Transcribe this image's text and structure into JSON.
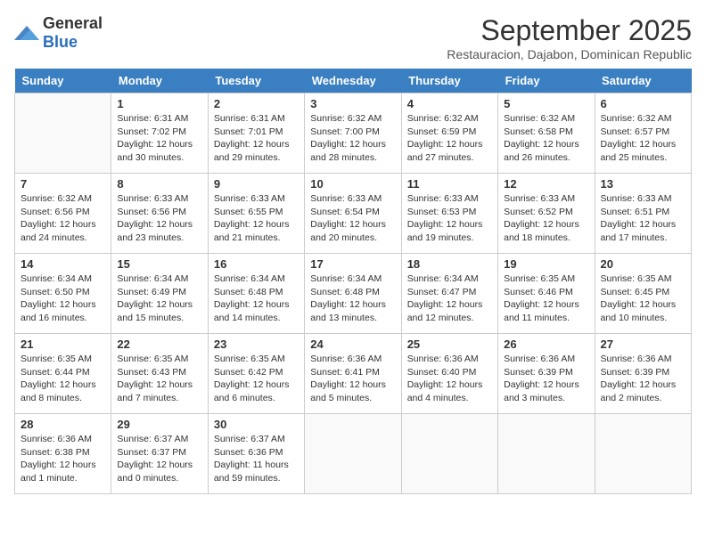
{
  "logo": {
    "general": "General",
    "blue": "Blue"
  },
  "title": "September 2025",
  "subtitle": "Restauracion, Dajabon, Dominican Republic",
  "days_of_week": [
    "Sunday",
    "Monday",
    "Tuesday",
    "Wednesday",
    "Thursday",
    "Friday",
    "Saturday"
  ],
  "weeks": [
    [
      {
        "day": "",
        "info": ""
      },
      {
        "day": "1",
        "info": "Sunrise: 6:31 AM\nSunset: 7:02 PM\nDaylight: 12 hours\nand 30 minutes."
      },
      {
        "day": "2",
        "info": "Sunrise: 6:31 AM\nSunset: 7:01 PM\nDaylight: 12 hours\nand 29 minutes."
      },
      {
        "day": "3",
        "info": "Sunrise: 6:32 AM\nSunset: 7:00 PM\nDaylight: 12 hours\nand 28 minutes."
      },
      {
        "day": "4",
        "info": "Sunrise: 6:32 AM\nSunset: 6:59 PM\nDaylight: 12 hours\nand 27 minutes."
      },
      {
        "day": "5",
        "info": "Sunrise: 6:32 AM\nSunset: 6:58 PM\nDaylight: 12 hours\nand 26 minutes."
      },
      {
        "day": "6",
        "info": "Sunrise: 6:32 AM\nSunset: 6:57 PM\nDaylight: 12 hours\nand 25 minutes."
      }
    ],
    [
      {
        "day": "7",
        "info": "Sunrise: 6:32 AM\nSunset: 6:56 PM\nDaylight: 12 hours\nand 24 minutes."
      },
      {
        "day": "8",
        "info": "Sunrise: 6:33 AM\nSunset: 6:56 PM\nDaylight: 12 hours\nand 23 minutes."
      },
      {
        "day": "9",
        "info": "Sunrise: 6:33 AM\nSunset: 6:55 PM\nDaylight: 12 hours\nand 21 minutes."
      },
      {
        "day": "10",
        "info": "Sunrise: 6:33 AM\nSunset: 6:54 PM\nDaylight: 12 hours\nand 20 minutes."
      },
      {
        "day": "11",
        "info": "Sunrise: 6:33 AM\nSunset: 6:53 PM\nDaylight: 12 hours\nand 19 minutes."
      },
      {
        "day": "12",
        "info": "Sunrise: 6:33 AM\nSunset: 6:52 PM\nDaylight: 12 hours\nand 18 minutes."
      },
      {
        "day": "13",
        "info": "Sunrise: 6:33 AM\nSunset: 6:51 PM\nDaylight: 12 hours\nand 17 minutes."
      }
    ],
    [
      {
        "day": "14",
        "info": "Sunrise: 6:34 AM\nSunset: 6:50 PM\nDaylight: 12 hours\nand 16 minutes."
      },
      {
        "day": "15",
        "info": "Sunrise: 6:34 AM\nSunset: 6:49 PM\nDaylight: 12 hours\nand 15 minutes."
      },
      {
        "day": "16",
        "info": "Sunrise: 6:34 AM\nSunset: 6:48 PM\nDaylight: 12 hours\nand 14 minutes."
      },
      {
        "day": "17",
        "info": "Sunrise: 6:34 AM\nSunset: 6:48 PM\nDaylight: 12 hours\nand 13 minutes."
      },
      {
        "day": "18",
        "info": "Sunrise: 6:34 AM\nSunset: 6:47 PM\nDaylight: 12 hours\nand 12 minutes."
      },
      {
        "day": "19",
        "info": "Sunrise: 6:35 AM\nSunset: 6:46 PM\nDaylight: 12 hours\nand 11 minutes."
      },
      {
        "day": "20",
        "info": "Sunrise: 6:35 AM\nSunset: 6:45 PM\nDaylight: 12 hours\nand 10 minutes."
      }
    ],
    [
      {
        "day": "21",
        "info": "Sunrise: 6:35 AM\nSunset: 6:44 PM\nDaylight: 12 hours\nand 8 minutes."
      },
      {
        "day": "22",
        "info": "Sunrise: 6:35 AM\nSunset: 6:43 PM\nDaylight: 12 hours\nand 7 minutes."
      },
      {
        "day": "23",
        "info": "Sunrise: 6:35 AM\nSunset: 6:42 PM\nDaylight: 12 hours\nand 6 minutes."
      },
      {
        "day": "24",
        "info": "Sunrise: 6:36 AM\nSunset: 6:41 PM\nDaylight: 12 hours\nand 5 minutes."
      },
      {
        "day": "25",
        "info": "Sunrise: 6:36 AM\nSunset: 6:40 PM\nDaylight: 12 hours\nand 4 minutes."
      },
      {
        "day": "26",
        "info": "Sunrise: 6:36 AM\nSunset: 6:39 PM\nDaylight: 12 hours\nand 3 minutes."
      },
      {
        "day": "27",
        "info": "Sunrise: 6:36 AM\nSunset: 6:39 PM\nDaylight: 12 hours\nand 2 minutes."
      }
    ],
    [
      {
        "day": "28",
        "info": "Sunrise: 6:36 AM\nSunset: 6:38 PM\nDaylight: 12 hours\nand 1 minute."
      },
      {
        "day": "29",
        "info": "Sunrise: 6:37 AM\nSunset: 6:37 PM\nDaylight: 12 hours\nand 0 minutes."
      },
      {
        "day": "30",
        "info": "Sunrise: 6:37 AM\nSunset: 6:36 PM\nDaylight: 11 hours\nand 59 minutes."
      },
      {
        "day": "",
        "info": ""
      },
      {
        "day": "",
        "info": ""
      },
      {
        "day": "",
        "info": ""
      },
      {
        "day": "",
        "info": ""
      }
    ]
  ]
}
